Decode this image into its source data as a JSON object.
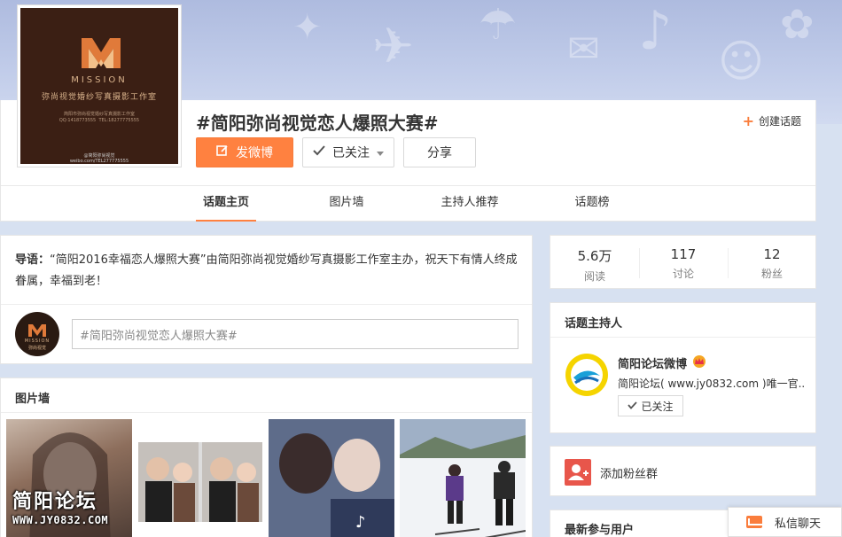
{
  "header": {
    "topic_title": "#简阳弥尚视觉恋人爆照大赛#",
    "post_button": "发微博",
    "follow_button": "已关注",
    "share_button": "分享",
    "create_topic": "创建话题"
  },
  "avatar_logo": {
    "brand_en": "MISSION",
    "brand_cn": "弥尚视觉婚纱写真摄影工作室",
    "small_print_1": "简阳市弥尚视觉婚纱写真摄影工作室",
    "small_print_2": "QQ:1418773555",
    "small_print_3": "TEL:18277775555",
    "weibo": "weibo.com/TEL277775555",
    "weibo_handle": "@简阳弥尚视觉"
  },
  "tabs": [
    {
      "label": "话题主页",
      "active": true
    },
    {
      "label": "图片墙",
      "active": false
    },
    {
      "label": "主持人推荐",
      "active": false
    },
    {
      "label": "话题榜",
      "active": false
    }
  ],
  "intro": {
    "prefix": "导语：",
    "text": "“简阳2016幸福恋人爆照大赛”由简阳弥尚视觉婚纱写真摄影工作室主办，祝天下有情人终成眷属，幸福到老！"
  },
  "post_box": {
    "avatar_brand": "MISSION",
    "avatar_cn": "弥尚视觉",
    "value": "#简阳弥尚视觉恋人爆照大赛#"
  },
  "photo_wall": {
    "title": "图片墙",
    "watermark_cn": "简阳论坛",
    "watermark_url": "WWW.JY0832.COM"
  },
  "stats": [
    {
      "value": "5.6万",
      "label": "阅读"
    },
    {
      "value": "117",
      "label": "讨论"
    },
    {
      "value": "12",
      "label": "粉丝"
    }
  ],
  "host": {
    "title": "话题主持人",
    "name": "简阳论坛微博",
    "description": "简阳论坛( www.jy0832.com )唯一官...",
    "follow_button": "已关注"
  },
  "fans_group": {
    "label": "添加粉丝群"
  },
  "recent_users": {
    "title": "最新参与用户"
  },
  "chat": {
    "label": "私信聊天"
  },
  "colors": {
    "accent": "#ff8140",
    "fans_icon": "#e8564b"
  }
}
